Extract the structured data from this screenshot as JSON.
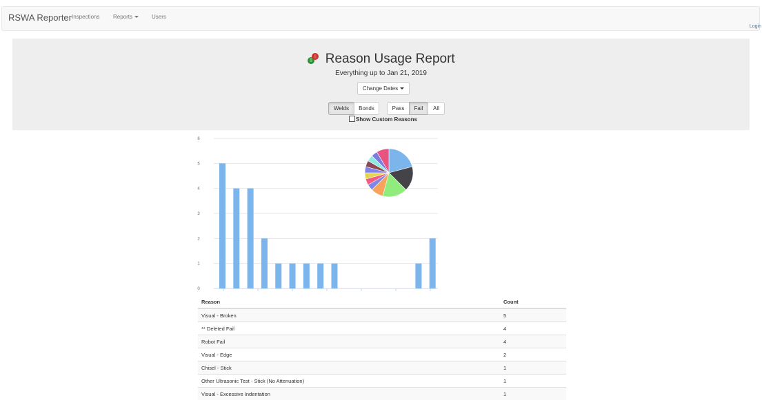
{
  "nav": {
    "brand": "RSWA Reporter",
    "items": [
      {
        "label": "Inspections",
        "dropdown": false
      },
      {
        "label": "Reports",
        "dropdown": true
      },
      {
        "label": "Users",
        "dropdown": false
      }
    ],
    "login": "Login"
  },
  "header": {
    "title": "Reason Usage Report",
    "subtitle": "Everything up to Jan 21, 2019",
    "change_dates": "Change Dates",
    "type_toggle": [
      {
        "label": "Welds",
        "active": true
      },
      {
        "label": "Bonds",
        "active": false
      }
    ],
    "result_toggle": [
      {
        "label": "Pass",
        "active": false
      },
      {
        "label": "Fail",
        "active": true
      },
      {
        "label": "All",
        "active": false
      }
    ],
    "show_custom_label": "Show Custom Reasons",
    "show_custom_checked": false
  },
  "chart_data": [
    {
      "type": "bar",
      "categories": [
        "Visual - Broken",
        "** Deleted Fail",
        "Robot Fail",
        "Visual - Edge",
        "Chisel - Stick",
        "Other Ultrasonic Test - Stick (No Attenuation)",
        "Visual - Excessive Indentation",
        "",
        "",
        "",
        "",
        "",
        "",
        "",
        "",
        ""
      ],
      "values": [
        5,
        4,
        4,
        2,
        1,
        1,
        1,
        1,
        1,
        0,
        0,
        0,
        0,
        0,
        1,
        2
      ],
      "ylim": [
        0,
        6
      ],
      "yticks": [
        "0",
        "1",
        "2",
        "3",
        "4",
        "5",
        "6"
      ],
      "grid": true,
      "bar_color": "#7cb5ec"
    },
    {
      "type": "pie",
      "slices": [
        {
          "value": 5,
          "color": "#7cb5ec"
        },
        {
          "value": 4,
          "color": "#434348"
        },
        {
          "value": 4,
          "color": "#90ed7d"
        },
        {
          "value": 2,
          "color": "#f7a35c"
        },
        {
          "value": 1,
          "color": "#8085e9"
        },
        {
          "value": 1,
          "color": "#f15c80"
        },
        {
          "value": 1,
          "color": "#e4d354"
        },
        {
          "value": 1,
          "color": "#8085e8"
        },
        {
          "value": 1,
          "color": "#8d4653"
        },
        {
          "value": 1,
          "color": "#91e8e1"
        },
        {
          "value": 1,
          "color": "#7c7ce0"
        },
        {
          "value": 2,
          "color": "#e75480"
        }
      ]
    }
  ],
  "table": {
    "headers": [
      "Reason",
      "Count"
    ],
    "rows": [
      [
        "Visual - Broken",
        "5"
      ],
      [
        "** Deleted Fail",
        "4"
      ],
      [
        "Robot Fail",
        "4"
      ],
      [
        "Visual - Edge",
        "2"
      ],
      [
        "Chisel - Stick",
        "1"
      ],
      [
        "Other Ultrasonic Test - Stick (No Attenuation)",
        "1"
      ],
      [
        "Visual - Excessive Indentation",
        "1"
      ]
    ]
  }
}
